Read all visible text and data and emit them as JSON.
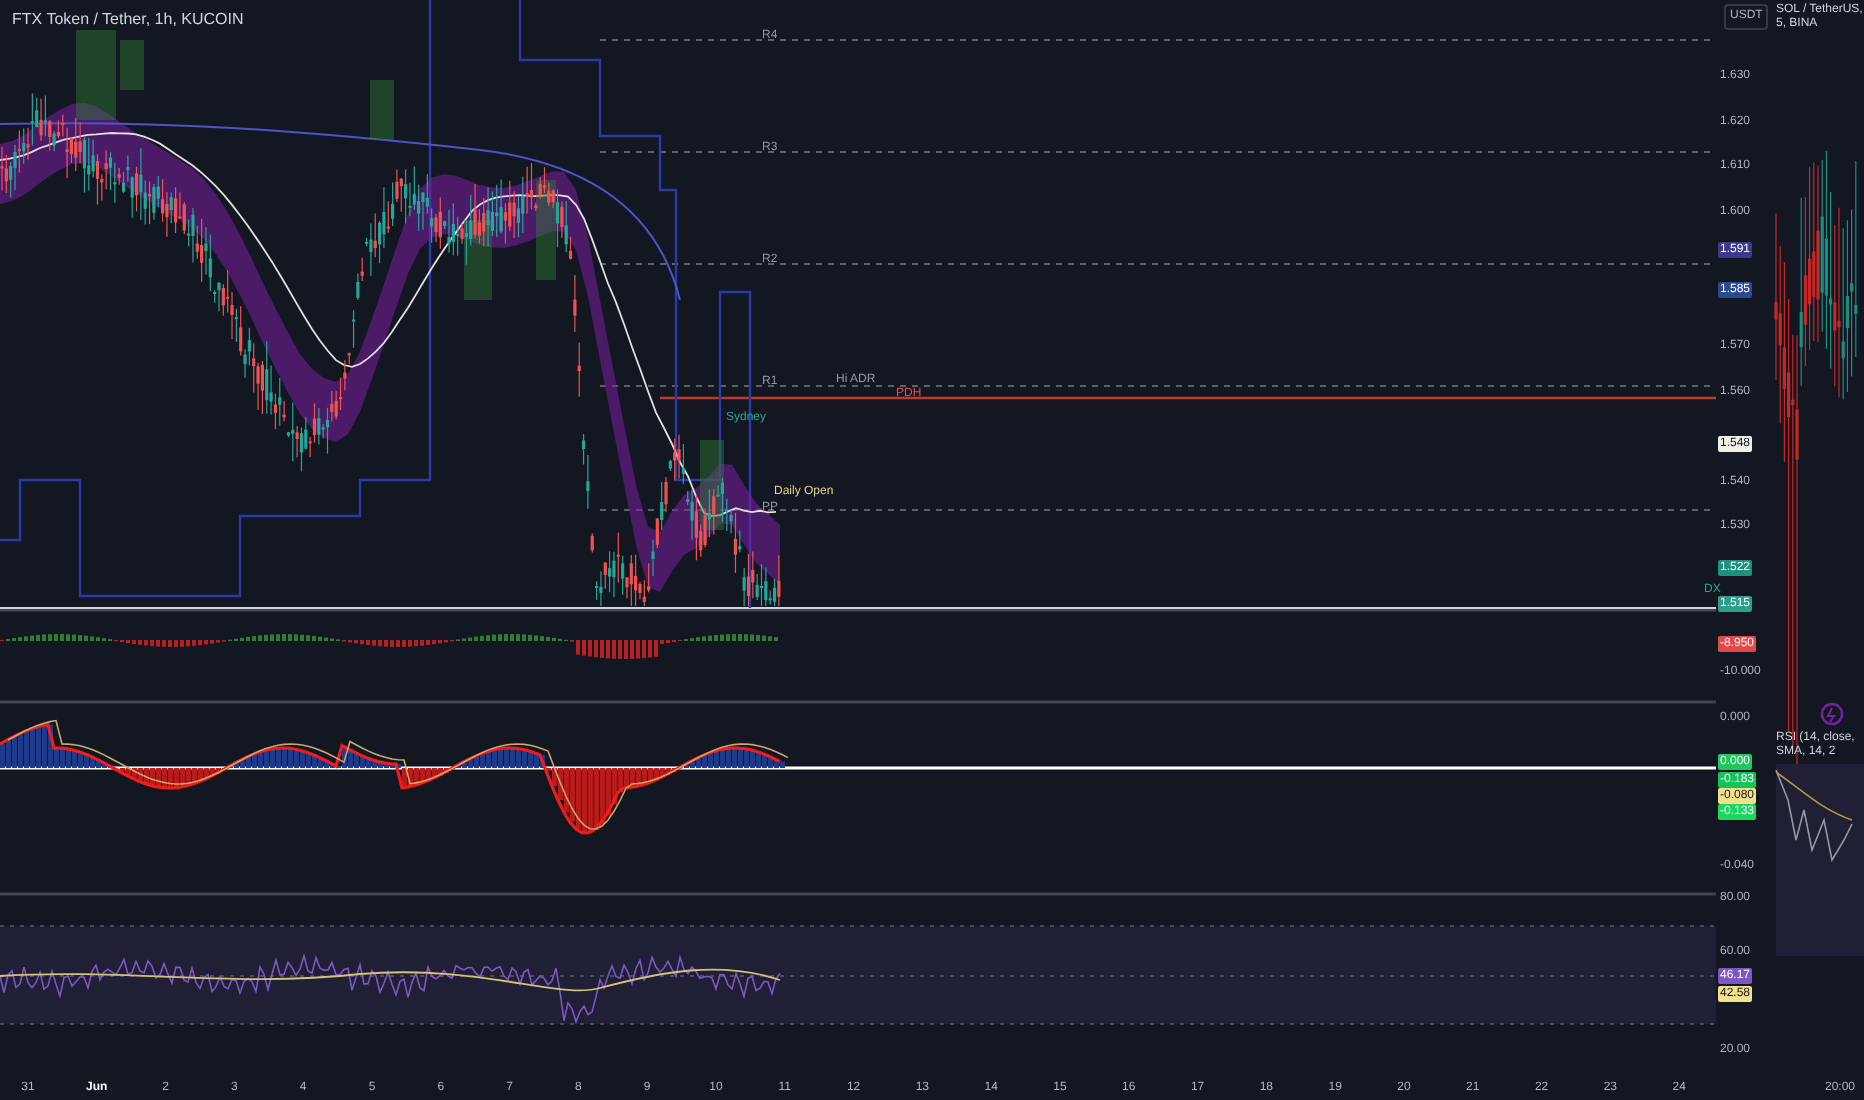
{
  "chart_title": "FTX Token / Tether, 1h, KUCOIN",
  "currency_button": "USDT",
  "level_labels": [
    {
      "text": "R4",
      "kind": "pivot"
    },
    {
      "text": "R3",
      "kind": "pivot"
    },
    {
      "text": "R2",
      "kind": "pivot"
    },
    {
      "text": "R1",
      "kind": "pivot"
    },
    {
      "text": "Hi ADR",
      "kind": "pivot"
    },
    {
      "text": "PDH",
      "kind": "high"
    },
    {
      "text": "Sydney",
      "kind": "session"
    },
    {
      "text": "Daily Open",
      "kind": "open"
    },
    {
      "text": "PP",
      "kind": "pivot"
    },
    {
      "text": "DX",
      "kind": "session"
    }
  ],
  "price_axis": [
    {
      "text": "1.630",
      "kind": "tick"
    },
    {
      "text": "1.620",
      "kind": "tick"
    },
    {
      "text": "1.610",
      "kind": "tick"
    },
    {
      "text": "1.600",
      "kind": "tick"
    },
    {
      "text": "1.591",
      "kind": "badge",
      "color": "#3d3a8c"
    },
    {
      "text": "1.585",
      "kind": "badge",
      "color": "#2a4a8f"
    },
    {
      "text": "1.570",
      "kind": "tick"
    },
    {
      "text": "1.560",
      "kind": "tick"
    },
    {
      "text": "1.548",
      "kind": "badge",
      "color": "#f0f0e8"
    },
    {
      "text": "1.540",
      "kind": "tick"
    },
    {
      "text": "1.530",
      "kind": "tick"
    },
    {
      "text": "1.522",
      "kind": "badge",
      "color": "#1f8f7f"
    },
    {
      "text": "1.515",
      "kind": "badge",
      "color": "#2e9e8a"
    },
    {
      "text": "-8.950",
      "kind": "badge",
      "color": "#e04a4a"
    },
    {
      "text": "-10.000",
      "kind": "tick"
    }
  ],
  "oscillator_axis": [
    {
      "text": "0.000",
      "kind": "tick"
    },
    {
      "text": "0.000",
      "kind": "badge",
      "color": "#22c55e"
    },
    {
      "text": "-0.183",
      "kind": "badge",
      "color": "#16c25a"
    },
    {
      "text": "-0.080",
      "kind": "badge",
      "color": "#f3e08a"
    },
    {
      "text": "-0.133",
      "kind": "badge",
      "color": "#1ed760"
    },
    {
      "text": "-0.040",
      "kind": "tick"
    }
  ],
  "rsi_axis": [
    {
      "text": "80.00",
      "kind": "tick"
    },
    {
      "text": "60.00",
      "kind": "tick"
    },
    {
      "text": "46.17",
      "kind": "badge",
      "color": "#7e57c2"
    },
    {
      "text": "42.58",
      "kind": "badge",
      "color": "#f3e08a"
    },
    {
      "text": "20.00",
      "kind": "tick"
    }
  ],
  "second_chart": {
    "title": "SOL / TetherUS, 5, BINA",
    "indicator": "RSI (14, close, SMA, 14, 2"
  },
  "time_axis": [
    {
      "text": "31",
      "selected": false
    },
    {
      "text": "Jun",
      "selected": true
    },
    {
      "text": "2",
      "selected": false
    },
    {
      "text": "3",
      "selected": false
    },
    {
      "text": "4",
      "selected": false
    },
    {
      "text": "5",
      "selected": false
    },
    {
      "text": "6",
      "selected": false
    },
    {
      "text": "7",
      "selected": false
    },
    {
      "text": "8",
      "selected": false
    },
    {
      "text": "9",
      "selected": false
    },
    {
      "text": "10",
      "selected": false
    },
    {
      "text": "11",
      "selected": false
    },
    {
      "text": "12",
      "selected": false
    },
    {
      "text": "13",
      "selected": false
    },
    {
      "text": "14",
      "selected": false
    },
    {
      "text": "15",
      "selected": false
    },
    {
      "text": "16",
      "selected": false
    },
    {
      "text": "17",
      "selected": false
    },
    {
      "text": "18",
      "selected": false
    },
    {
      "text": "19",
      "selected": false
    },
    {
      "text": "20",
      "selected": false
    },
    {
      "text": "21",
      "selected": false
    },
    {
      "text": "22",
      "selected": false
    },
    {
      "text": "23",
      "selected": false
    },
    {
      "text": "24",
      "selected": false
    },
    {
      "text": "20:00",
      "selected": false
    }
  ]
}
